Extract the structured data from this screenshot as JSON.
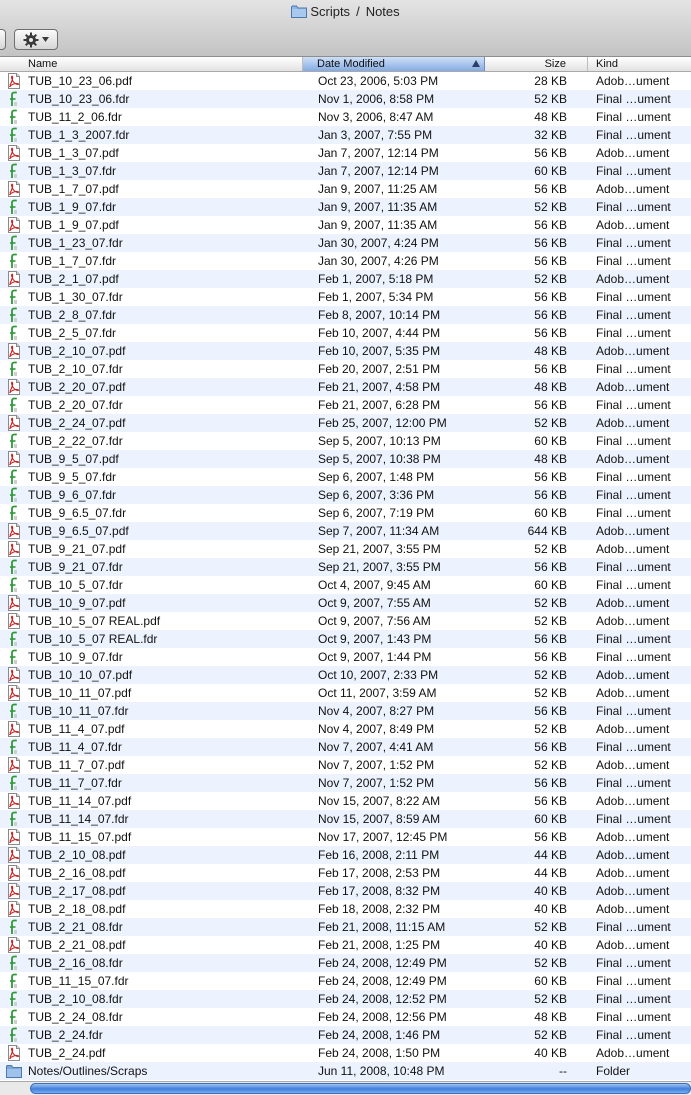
{
  "window": {
    "title_parent": "Scripts",
    "title_separator": "/",
    "title_folder": "Notes",
    "icon": "folder-icon"
  },
  "toolbar": {
    "action_icon": "gear-icon"
  },
  "columns": {
    "name": "Name",
    "date": "Date Modified",
    "size": "Size",
    "kind": "Kind",
    "sorted_by": "Date Modified"
  },
  "files": [
    {
      "type": "pdf",
      "name": "TUB_10_23_06.pdf",
      "date": "Oct 23, 2006, 5:03 PM",
      "size": "28 KB",
      "kind": "Adob…ument"
    },
    {
      "type": "fdr",
      "name": "TUB_10_23_06.fdr",
      "date": "Nov 1, 2006, 8:58 PM",
      "size": "52 KB",
      "kind": "Final …ument"
    },
    {
      "type": "fdr",
      "name": "TUB_11_2_06.fdr",
      "date": "Nov 3, 2006, 8:47 AM",
      "size": "48 KB",
      "kind": "Final …ument"
    },
    {
      "type": "fdr",
      "name": "TUB_1_3_2007.fdr",
      "date": "Jan 3, 2007, 7:55 PM",
      "size": "32 KB",
      "kind": "Final …ument"
    },
    {
      "type": "pdf",
      "name": "TUB_1_3_07.pdf",
      "date": "Jan 7, 2007, 12:14 PM",
      "size": "56 KB",
      "kind": "Adob…ument"
    },
    {
      "type": "fdr",
      "name": "TUB_1_3_07.fdr",
      "date": "Jan 7, 2007, 12:14 PM",
      "size": "60 KB",
      "kind": "Final …ument"
    },
    {
      "type": "pdf",
      "name": "TUB_1_7_07.pdf",
      "date": "Jan 9, 2007, 11:25 AM",
      "size": "56 KB",
      "kind": "Adob…ument"
    },
    {
      "type": "fdr",
      "name": "TUB_1_9_07.fdr",
      "date": "Jan 9, 2007, 11:35 AM",
      "size": "52 KB",
      "kind": "Final …ument"
    },
    {
      "type": "pdf",
      "name": "TUB_1_9_07.pdf",
      "date": "Jan 9, 2007, 11:35 AM",
      "size": "56 KB",
      "kind": "Adob…ument"
    },
    {
      "type": "fdr",
      "name": "TUB_1_23_07.fdr",
      "date": "Jan 30, 2007, 4:24 PM",
      "size": "56 KB",
      "kind": "Final …ument"
    },
    {
      "type": "fdr",
      "name": "TUB_1_7_07.fdr",
      "date": "Jan 30, 2007, 4:26 PM",
      "size": "56 KB",
      "kind": "Final …ument"
    },
    {
      "type": "pdf",
      "name": "TUB_2_1_07.pdf",
      "date": "Feb 1, 2007, 5:18 PM",
      "size": "52 KB",
      "kind": "Adob…ument"
    },
    {
      "type": "fdr",
      "name": "TUB_1_30_07.fdr",
      "date": "Feb 1, 2007, 5:34 PM",
      "size": "56 KB",
      "kind": "Final …ument"
    },
    {
      "type": "fdr",
      "name": "TUB_2_8_07.fdr",
      "date": "Feb 8, 2007, 10:14 PM",
      "size": "56 KB",
      "kind": "Final …ument"
    },
    {
      "type": "fdr",
      "name": "TUB_2_5_07.fdr",
      "date": "Feb 10, 2007, 4:44 PM",
      "size": "56 KB",
      "kind": "Final …ument"
    },
    {
      "type": "pdf",
      "name": "TUB_2_10_07.pdf",
      "date": "Feb 10, 2007, 5:35 PM",
      "size": "48 KB",
      "kind": "Adob…ument"
    },
    {
      "type": "fdr",
      "name": "TUB_2_10_07.fdr",
      "date": "Feb 20, 2007, 2:51 PM",
      "size": "56 KB",
      "kind": "Final …ument"
    },
    {
      "type": "pdf",
      "name": "TUB_2_20_07.pdf",
      "date": "Feb 21, 2007, 4:58 PM",
      "size": "48 KB",
      "kind": "Adob…ument"
    },
    {
      "type": "fdr",
      "name": "TUB_2_20_07.fdr",
      "date": "Feb 21, 2007, 6:28 PM",
      "size": "56 KB",
      "kind": "Final …ument"
    },
    {
      "type": "pdf",
      "name": "TUB_2_24_07.pdf",
      "date": "Feb 25, 2007, 12:00 PM",
      "size": "52 KB",
      "kind": "Adob…ument"
    },
    {
      "type": "fdr",
      "name": "TUB_2_22_07.fdr",
      "date": "Sep 5, 2007, 10:13 PM",
      "size": "60 KB",
      "kind": "Final …ument"
    },
    {
      "type": "pdf",
      "name": "TUB_9_5_07.pdf",
      "date": "Sep 5, 2007, 10:38 PM",
      "size": "48 KB",
      "kind": "Adob…ument"
    },
    {
      "type": "fdr",
      "name": "TUB_9_5_07.fdr",
      "date": "Sep 6, 2007, 1:48 PM",
      "size": "56 KB",
      "kind": "Final …ument"
    },
    {
      "type": "fdr",
      "name": "TUB_9_6_07.fdr",
      "date": "Sep 6, 2007, 3:36 PM",
      "size": "56 KB",
      "kind": "Final …ument"
    },
    {
      "type": "fdr",
      "name": "TUB_9_6.5_07.fdr",
      "date": "Sep 6, 2007, 7:19 PM",
      "size": "60 KB",
      "kind": "Final …ument"
    },
    {
      "type": "pdf",
      "name": "TUB_9_6.5_07.pdf",
      "date": "Sep 7, 2007, 11:34 AM",
      "size": "644 KB",
      "kind": "Adob…ument"
    },
    {
      "type": "pdf",
      "name": "TUB_9_21_07.pdf",
      "date": "Sep 21, 2007, 3:55 PM",
      "size": "52 KB",
      "kind": "Adob…ument"
    },
    {
      "type": "fdr",
      "name": "TUB_9_21_07.fdr",
      "date": "Sep 21, 2007, 3:55 PM",
      "size": "56 KB",
      "kind": "Final …ument"
    },
    {
      "type": "fdr",
      "name": "TUB_10_5_07.fdr",
      "date": "Oct 4, 2007, 9:45 AM",
      "size": "60 KB",
      "kind": "Final …ument"
    },
    {
      "type": "pdf",
      "name": "TUB_10_9_07.pdf",
      "date": "Oct 9, 2007, 7:55 AM",
      "size": "52 KB",
      "kind": "Adob…ument"
    },
    {
      "type": "pdf",
      "name": "TUB_10_5_07 REAL.pdf",
      "date": "Oct 9, 2007, 7:56 AM",
      "size": "52 KB",
      "kind": "Adob…ument"
    },
    {
      "type": "fdr",
      "name": "TUB_10_5_07 REAL.fdr",
      "date": "Oct 9, 2007, 1:43 PM",
      "size": "56 KB",
      "kind": "Final …ument"
    },
    {
      "type": "fdr",
      "name": "TUB_10_9_07.fdr",
      "date": "Oct 9, 2007, 1:44 PM",
      "size": "56 KB",
      "kind": "Final …ument"
    },
    {
      "type": "pdf",
      "name": "TUB_10_10_07.pdf",
      "date": "Oct 10, 2007, 2:33 PM",
      "size": "52 KB",
      "kind": "Adob…ument"
    },
    {
      "type": "pdf",
      "name": "TUB_10_11_07.pdf",
      "date": "Oct 11, 2007, 3:59 AM",
      "size": "52 KB",
      "kind": "Adob…ument"
    },
    {
      "type": "fdr",
      "name": "TUB_10_11_07.fdr",
      "date": "Nov 4, 2007, 8:27 PM",
      "size": "56 KB",
      "kind": "Final …ument"
    },
    {
      "type": "pdf",
      "name": "TUB_11_4_07.pdf",
      "date": "Nov 4, 2007, 8:49 PM",
      "size": "52 KB",
      "kind": "Adob…ument"
    },
    {
      "type": "fdr",
      "name": "TUB_11_4_07.fdr",
      "date": "Nov 7, 2007, 4:41 AM",
      "size": "56 KB",
      "kind": "Final …ument"
    },
    {
      "type": "pdf",
      "name": "TUB_11_7_07.pdf",
      "date": "Nov 7, 2007, 1:52 PM",
      "size": "52 KB",
      "kind": "Adob…ument"
    },
    {
      "type": "fdr",
      "name": "TUB_11_7_07.fdr",
      "date": "Nov 7, 2007, 1:52 PM",
      "size": "56 KB",
      "kind": "Final …ument"
    },
    {
      "type": "pdf",
      "name": "TUB_11_14_07.pdf",
      "date": "Nov 15, 2007, 8:22 AM",
      "size": "56 KB",
      "kind": "Adob…ument"
    },
    {
      "type": "fdr",
      "name": "TUB_11_14_07.fdr",
      "date": "Nov 15, 2007, 8:59 AM",
      "size": "60 KB",
      "kind": "Final …ument"
    },
    {
      "type": "pdf",
      "name": "TUB_11_15_07.pdf",
      "date": "Nov 17, 2007, 12:45 PM",
      "size": "56 KB",
      "kind": "Adob…ument"
    },
    {
      "type": "pdf",
      "name": "TUB_2_10_08.pdf",
      "date": "Feb 16, 2008, 2:11 PM",
      "size": "44 KB",
      "kind": "Adob…ument"
    },
    {
      "type": "pdf",
      "name": "TUB_2_16_08.pdf",
      "date": "Feb 17, 2008, 2:53 PM",
      "size": "44 KB",
      "kind": "Adob…ument"
    },
    {
      "type": "pdf",
      "name": "TUB_2_17_08.pdf",
      "date": "Feb 17, 2008, 8:32 PM",
      "size": "40 KB",
      "kind": "Adob…ument"
    },
    {
      "type": "pdf",
      "name": "TUB_2_18_08.pdf",
      "date": "Feb 18, 2008, 2:32 PM",
      "size": "40 KB",
      "kind": "Adob…ument"
    },
    {
      "type": "fdr",
      "name": "TUB_2_21_08.fdr",
      "date": "Feb 21, 2008, 11:15 AM",
      "size": "52 KB",
      "kind": "Final …ument"
    },
    {
      "type": "pdf",
      "name": "TUB_2_21_08.pdf",
      "date": "Feb 21, 2008, 1:25 PM",
      "size": "40 KB",
      "kind": "Adob…ument"
    },
    {
      "type": "fdr",
      "name": "TUB_2_16_08.fdr",
      "date": "Feb 24, 2008, 12:49 PM",
      "size": "52 KB",
      "kind": "Final …ument"
    },
    {
      "type": "fdr",
      "name": "TUB_11_15_07.fdr",
      "date": "Feb 24, 2008, 12:49 PM",
      "size": "60 KB",
      "kind": "Final …ument"
    },
    {
      "type": "fdr",
      "name": "TUB_2_10_08.fdr",
      "date": "Feb 24, 2008, 12:52 PM",
      "size": "52 KB",
      "kind": "Final …ument"
    },
    {
      "type": "fdr",
      "name": "TUB_2_24_08.fdr",
      "date": "Feb 24, 2008, 12:56 PM",
      "size": "48 KB",
      "kind": "Final …ument"
    },
    {
      "type": "fdr",
      "name": "TUB_2_24.fdr",
      "date": "Feb 24, 2008, 1:46 PM",
      "size": "52 KB",
      "kind": "Final …ument"
    },
    {
      "type": "pdf",
      "name": "TUB_2_24.pdf",
      "date": "Feb 24, 2008, 1:50 PM",
      "size": "40 KB",
      "kind": "Adob…ument"
    },
    {
      "type": "folder",
      "name": "Notes/Outlines/Scraps",
      "date": "Jun 11, 2008, 10:48 PM",
      "size": "--",
      "kind": "Folder"
    }
  ],
  "colors": {
    "row_stripe": "#edf3fe",
    "sorted_header": "#86abe2",
    "pdf_icon": "#c8201e",
    "fdr_icon": "#2f9a3a",
    "folder_icon": "#7fa7d6"
  }
}
